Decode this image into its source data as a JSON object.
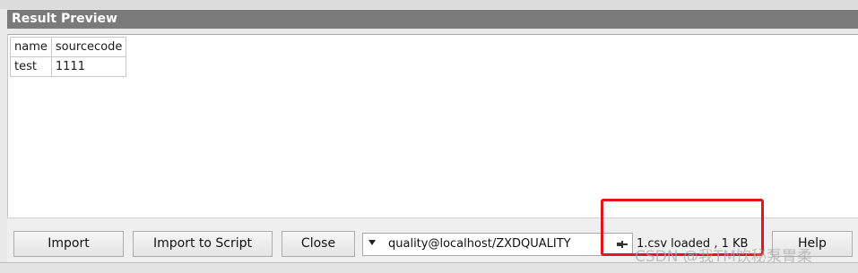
{
  "panel": {
    "title": "Result Preview"
  },
  "preview_table": {
    "columns": [
      "name",
      "sourcecode"
    ],
    "rows": [
      [
        "test",
        "1111"
      ]
    ]
  },
  "buttons": {
    "import_label": "Import",
    "import_script_label": "Import to Script",
    "close_label": "Close",
    "help_label": "Help"
  },
  "connection": {
    "selected": "quality@localhost/ZXDQUALITY",
    "icon": "pin-icon"
  },
  "status": {
    "text": "1.csv loaded , 1 KB"
  },
  "watermark": {
    "text": "CSDN @我TM饮秘泵胃柔"
  },
  "colors": {
    "header_bg": "#7a7a7a",
    "highlight": "#e8141c"
  }
}
